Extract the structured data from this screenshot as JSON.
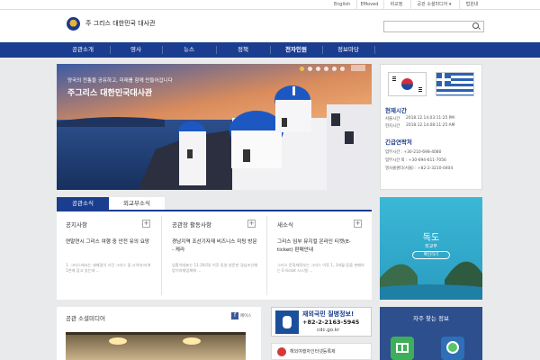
{
  "utility": {
    "items": [
      "English",
      "EMoved",
      "비교정",
      "공관 소셜미디어 ▾",
      "법원내"
    ]
  },
  "header": {
    "title": "주 그리스 대한민국 대사관",
    "search_placeholder": ""
  },
  "nav": {
    "items": [
      "공관소개",
      "영사",
      "뉴스",
      "정책",
      "전자민원",
      "정보마당"
    ]
  },
  "hero": {
    "line1": "양국의 전통을 공유하고, 미래를 함께 만들어갑니다",
    "line2": "주그리스 대한민국대사관",
    "slide_count": 6
  },
  "info": {
    "time_heading": "현재시간",
    "seoul_label": "서울시간",
    "seoul_value": "2018.12.14.03:11:25 PM",
    "local_label": "현지시간",
    "local_value": "2018.12.14.08:11:25 AM",
    "contact_heading": "긴급연락처",
    "contact1": "업무시간 : +30-210-698-4080",
    "contact2": "업무시간 외 : +30-694-611-7056",
    "contact3": "영사콜센터(서울) : +82-2-3210-0404"
  },
  "news": {
    "tab_active": "공관소식",
    "tab_other": "외교부소식",
    "col1": {
      "heading": "공지사항",
      "title": "연말연시 그리스 여행 중 안전 유의 요망",
      "summary": "1. 그리스에서는 새해맞이 기간 그리스 및 시이마크(여 1천에 감고 있는데 …"
    },
    "col2": {
      "heading": "공관장 활동사항",
      "title": "경남지역 조선기자재 비즈니스 미팅 방문 - 케라",
      "summary": "임홍석대표는 11.20(화) 이후 동일 방문한 경남조선해양기자재업체에 …"
    },
    "col3": {
      "heading": "새소식",
      "title": "그리스 임부 뮤지컬 온라인 티켓(E-ticket) 판매안내",
      "summary": "그리스 문화체육부는 그리스 이후 1, 3개월 등을 판매하는 E-ticket 시스템 …"
    }
  },
  "dokdo": {
    "title": "독도",
    "subtitle": "외교부",
    "button": "확인하기"
  },
  "bottom": {
    "media_heading": "공관 소셜미디어",
    "media_link": "페이스",
    "cdc_line1": "재외국민 질병정보!",
    "cdc_line2": "+82-2-2163-5945",
    "cdc_line3": "cdc.go.kr",
    "safety_text": "해외여행자인터넷등록제",
    "quick_heading": "자주 찾는 정보"
  }
}
